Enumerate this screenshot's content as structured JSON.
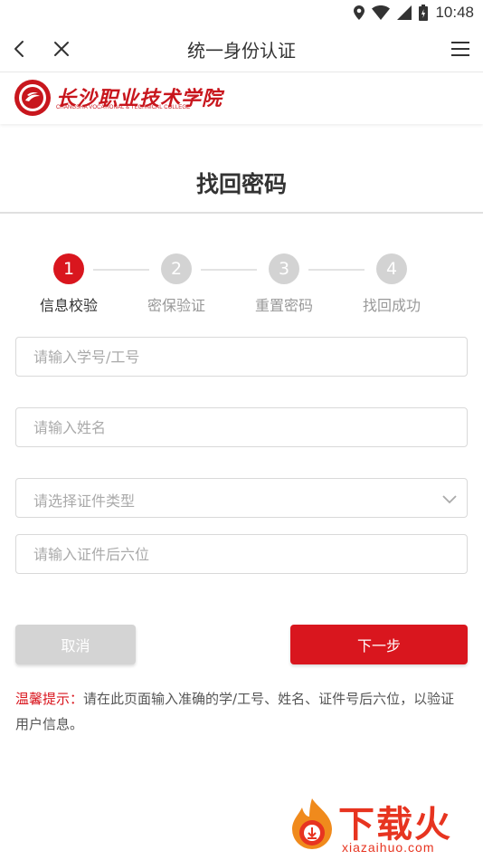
{
  "status_bar": {
    "time": "10:48"
  },
  "nav": {
    "title": "统一身份认证"
  },
  "logo": {
    "name_cn": "长沙职业技术学院",
    "name_en": "CHANGSHA VOCATIONAL & TECHNICAL COLLEGE"
  },
  "page": {
    "heading": "找回密码"
  },
  "steps": [
    {
      "number": "1",
      "label": "信息校验",
      "active": true
    },
    {
      "number": "2",
      "label": "密保验证",
      "active": false
    },
    {
      "number": "3",
      "label": "重置密码",
      "active": false
    },
    {
      "number": "4",
      "label": "找回成功",
      "active": false
    }
  ],
  "form": {
    "id_placeholder": "请输入学号/工号",
    "name_placeholder": "请输入姓名",
    "id_type_placeholder": "请选择证件类型",
    "id_last6_placeholder": "请输入证件后六位"
  },
  "buttons": {
    "cancel": "取消",
    "next": "下一步"
  },
  "tip": {
    "label": "温馨提示：",
    "text": "请在此页面输入准确的学/工号、姓名、证件号后六位，以验证用户信息。"
  },
  "watermark": {
    "brand": "下载火",
    "url": "xiazaihuo.com"
  },
  "colors": {
    "accent": "#d9161e",
    "step_inactive": "#d3d3d3",
    "brand_red": "#c8161d"
  }
}
